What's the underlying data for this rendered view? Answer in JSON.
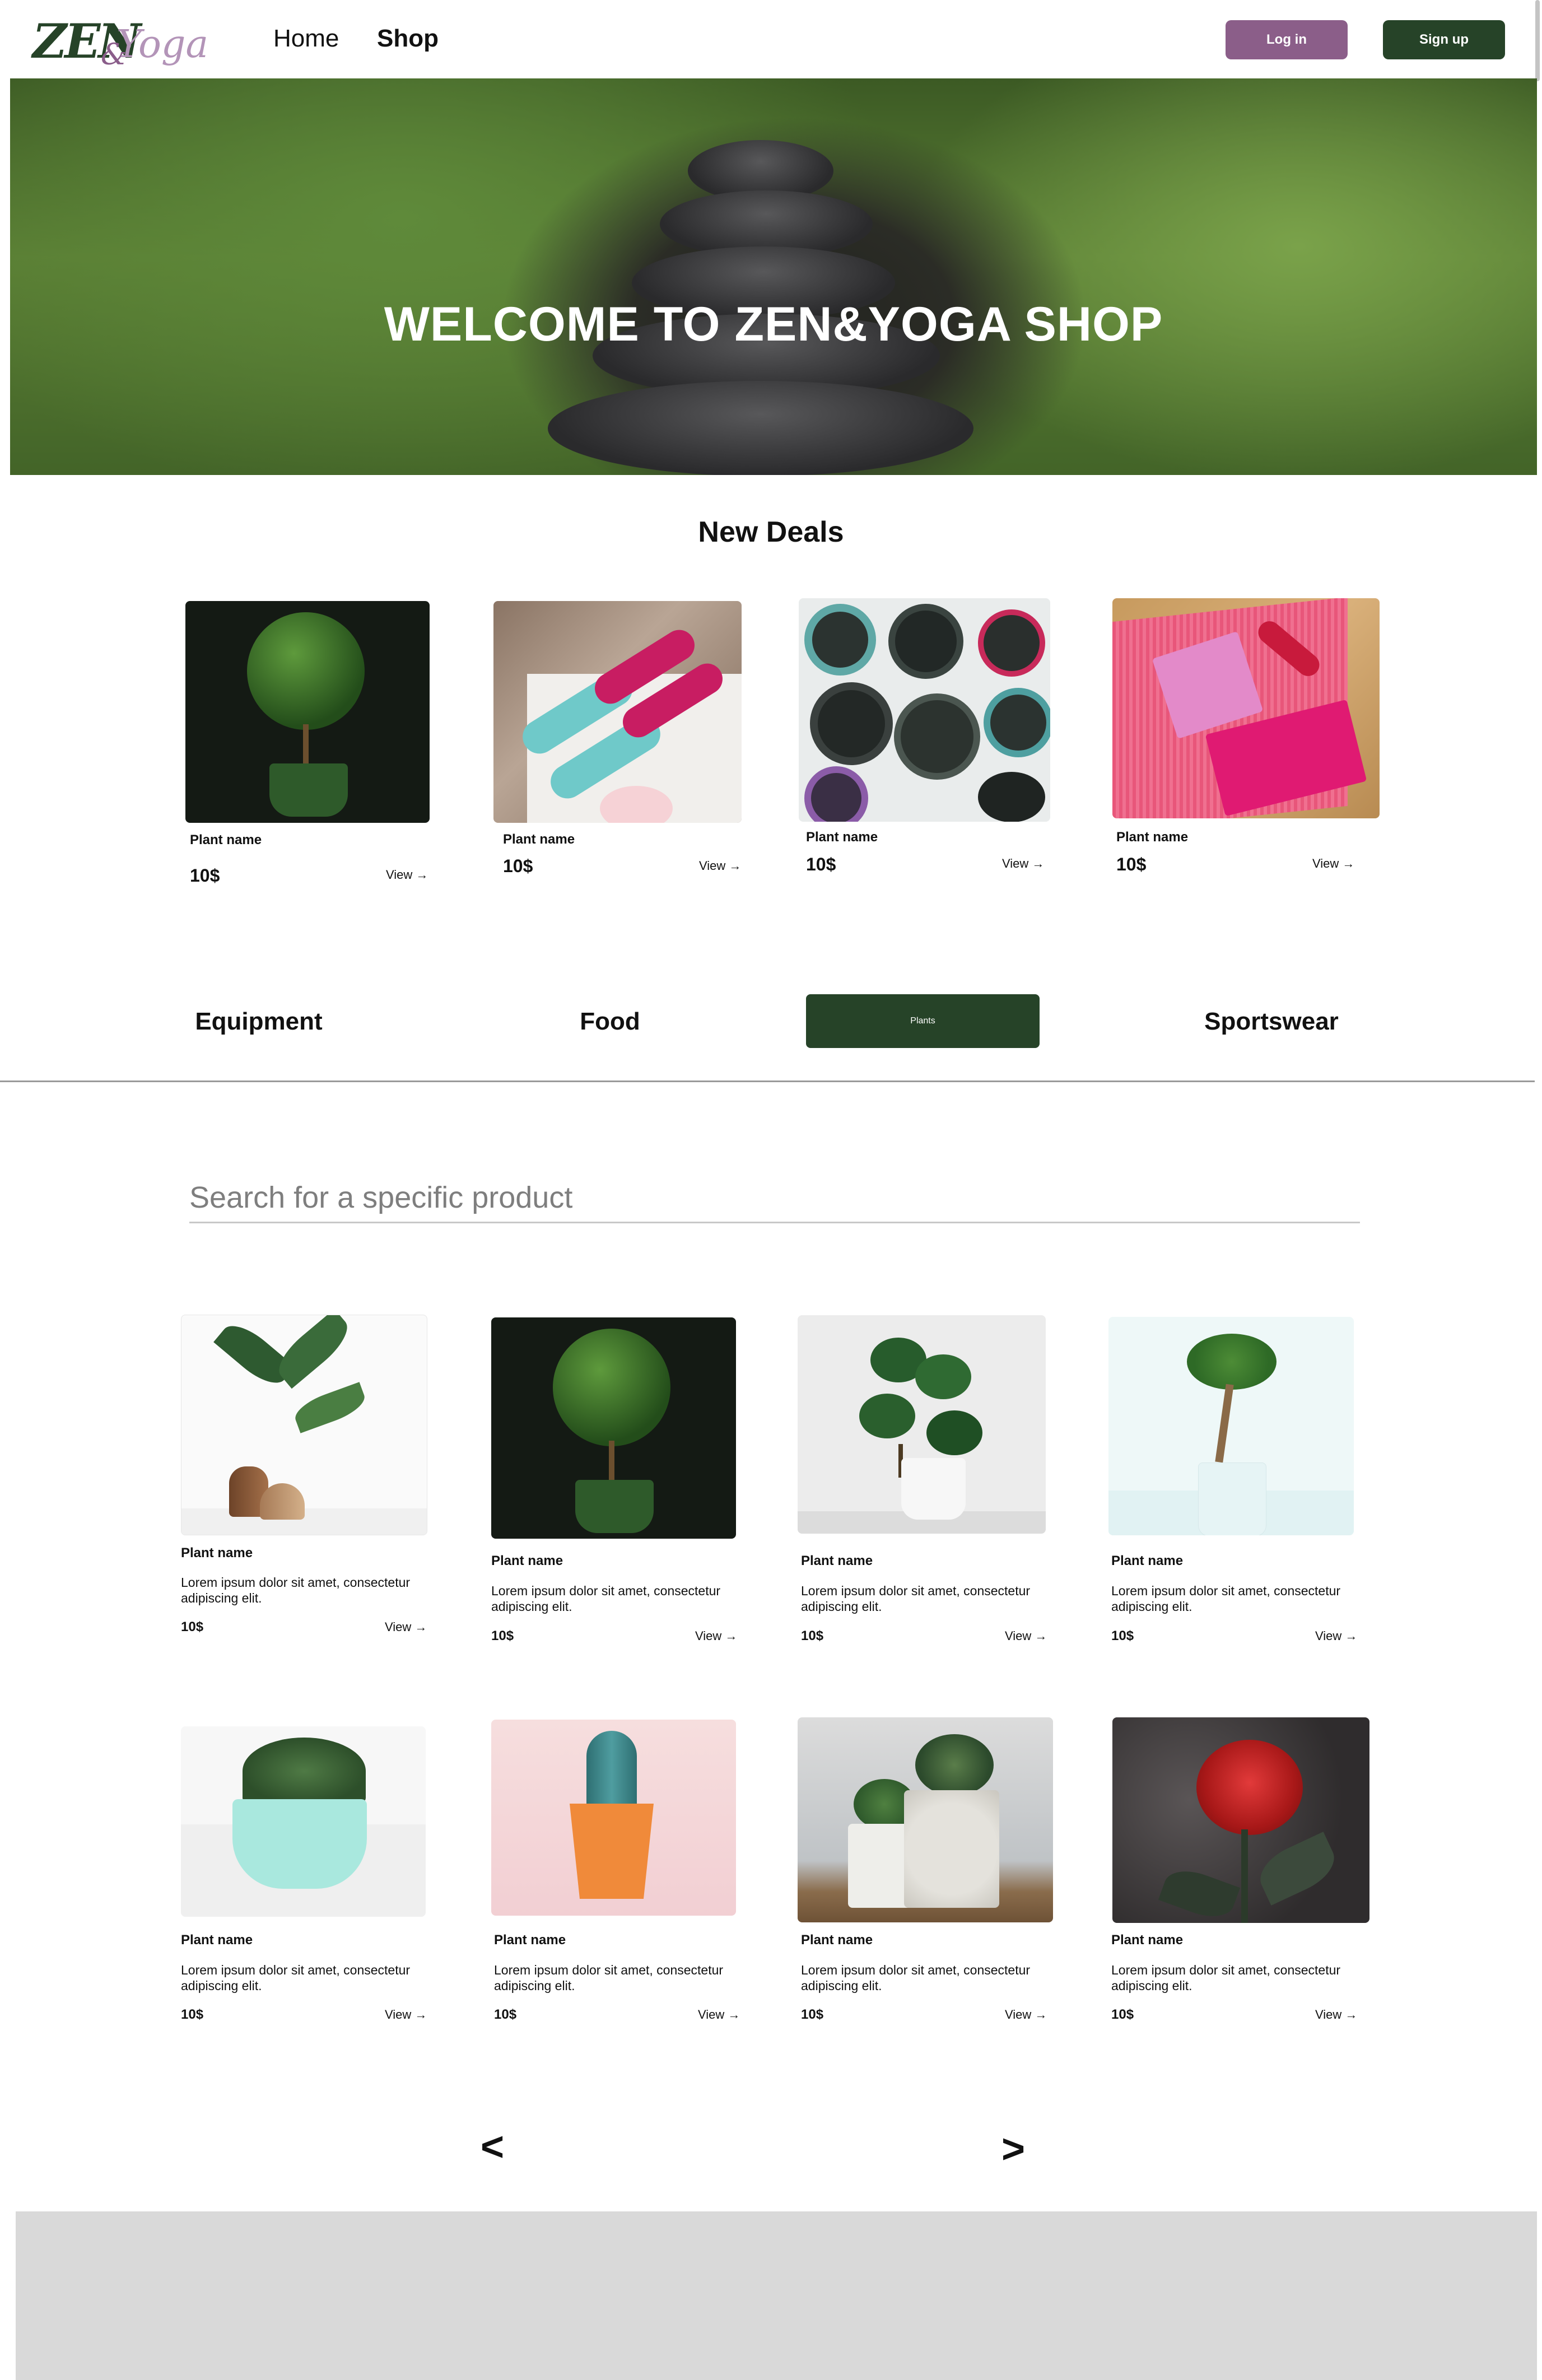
{
  "header": {
    "logo": {
      "zen": "ZEN",
      "amp": "&",
      "yoga": "Yoga"
    },
    "nav": [
      {
        "label": "Home"
      },
      {
        "label": "Shop"
      }
    ],
    "login_label": "Log in",
    "signup_label": "Sign up"
  },
  "hero": {
    "title": "WELCOME TO ZEN&YOGA SHOP"
  },
  "deals": {
    "title": "New Deals",
    "items": [
      {
        "name": "Plant name",
        "price": "10$",
        "view": "View →"
      },
      {
        "name": "Plant name",
        "price": "10$",
        "view": "View →"
      },
      {
        "name": "Plant name",
        "price": "10$",
        "view": "View →"
      },
      {
        "name": "Plant name",
        "price": "10$",
        "view": "View →"
      }
    ]
  },
  "categories": [
    {
      "label": "Equipment"
    },
    {
      "label": "Food"
    },
    {
      "label": "Plants",
      "selected": true
    },
    {
      "label": "Sportswear"
    }
  ],
  "search": {
    "placeholder": "Search for a specific product"
  },
  "products": [
    {
      "name": "Plant name",
      "description": "Lorem ipsum dolor sit amet, consectetur adipiscing elit.",
      "price": "10$",
      "view": "View →"
    },
    {
      "name": "Plant name",
      "description": "Lorem ipsum dolor sit amet, consectetur adipiscing elit.",
      "price": "10$",
      "view": "View →"
    },
    {
      "name": "Plant name",
      "description": "Lorem ipsum dolor sit amet, consectetur adipiscing elit.",
      "price": "10$",
      "view": "View →"
    },
    {
      "name": "Plant name",
      "description": "Lorem ipsum dolor sit amet, consectetur adipiscing elit.",
      "price": "10$",
      "view": "View →"
    },
    {
      "name": "Plant name",
      "description": "Lorem ipsum dolor sit amet, consectetur adipiscing elit.",
      "price": "10$",
      "view": "View →"
    },
    {
      "name": "Plant name",
      "description": "Lorem ipsum dolor sit amet, consectetur adipiscing elit.",
      "price": "10$",
      "view": "View →"
    },
    {
      "name": "Plant name",
      "description": "Lorem ipsum dolor sit amet, consectetur adipiscing elit.",
      "price": "10$",
      "view": "View →"
    },
    {
      "name": "Plant name",
      "description": "Lorem ipsum dolor sit amet, consectetur adipiscing elit.",
      "price": "10$",
      "view": "View →"
    }
  ],
  "pagination": {
    "prev": "<",
    "next": ">"
  },
  "colors": {
    "primary_green": "#264328",
    "accent_purple": "#8b5e89",
    "footer_gray": "#d9d9d9"
  }
}
